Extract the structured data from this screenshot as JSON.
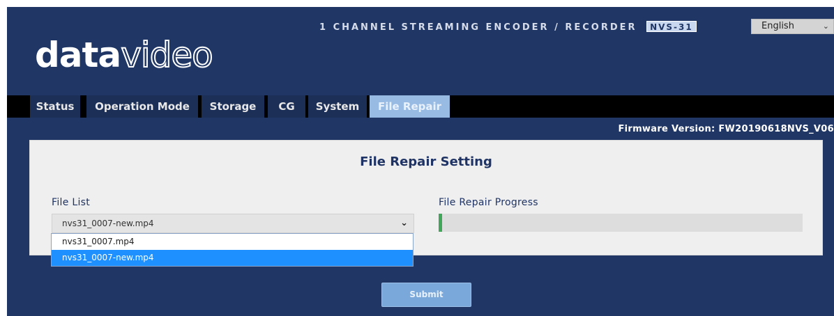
{
  "header": {
    "logo_bold": "data",
    "logo_thin": "video",
    "product_title": "1 CHANNEL STREAMING ENCODER / RECORDER",
    "model": "NVS-31",
    "language": "English"
  },
  "nav": {
    "tabs": [
      {
        "label": "Status"
      },
      {
        "label": "Operation Mode"
      },
      {
        "label": "Storage"
      },
      {
        "label": "CG"
      },
      {
        "label": "System"
      },
      {
        "label": "File Repair",
        "active": true
      }
    ]
  },
  "firmware": "Firmware Version: FW20190618NVS_V06",
  "panel": {
    "title": "File Repair Setting",
    "file_list_label": "File List",
    "progress_label": "File Repair Progress",
    "selected_file": "nvs31_0007-new.mp4",
    "progress_fraction": 0.01,
    "options": [
      "nvs31_0007.mp4",
      "nvs31_0007-new.mp4"
    ],
    "selected_option_index": 1
  },
  "submit_label": "Submit",
  "colors": {
    "background": "#203766",
    "active_tab": "#98bbe3",
    "progress": "#42a65a",
    "dropdown_highlight": "#1e90ff"
  }
}
